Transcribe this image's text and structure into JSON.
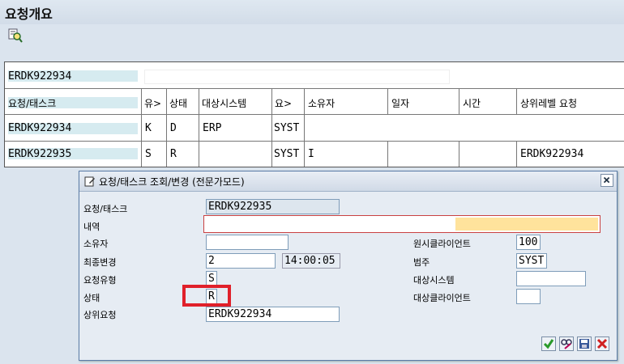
{
  "window": {
    "title": "요청개요"
  },
  "toolbar": {
    "icons": [
      "find-icon"
    ]
  },
  "overview": {
    "top_request": "ERDK922934",
    "columns": [
      "요청/태스크",
      "유>",
      "상태",
      "대상시스템",
      "요>",
      "소유자",
      "일자",
      "시간",
      "상위레벨 요청"
    ],
    "rows": [
      {
        "req": "ERDK922934",
        "type": "K",
        "status": "D",
        "target": "ERP",
        "cat": "SYST",
        "owner": "",
        "date": "",
        "time": "",
        "parent": ""
      },
      {
        "req": "ERDK922935",
        "type": "S",
        "status": "R",
        "target": "",
        "cat": "SYST",
        "owner": "I",
        "date": "",
        "time": "",
        "parent": "ERDK922934"
      }
    ]
  },
  "dialog": {
    "title": "요청/태스크 조회/변경 (전문가모드)",
    "labels": {
      "request": "요청/태스크",
      "desc": "내역",
      "owner": "소유자",
      "last_change": "최종변경",
      "req_type": "요청유형",
      "status": "상태",
      "parent": "상위요청",
      "src_client": "원시클라이언트",
      "category": "범주",
      "target_sys": "대상시스템",
      "target_client": "대상클라이언트"
    },
    "values": {
      "request": "ERDK922935",
      "desc": "",
      "owner": "",
      "date": "2",
      "time": "14:00:05",
      "req_type": "S",
      "status": "R",
      "parent": "ERDK922934",
      "src_client": "100",
      "category": "SYST",
      "target_sys": "",
      "target_client": ""
    },
    "highlight_color": "#e0202a"
  },
  "colors": {
    "accent": "#d6ebf0",
    "desc_fill": "#ffe39c"
  }
}
